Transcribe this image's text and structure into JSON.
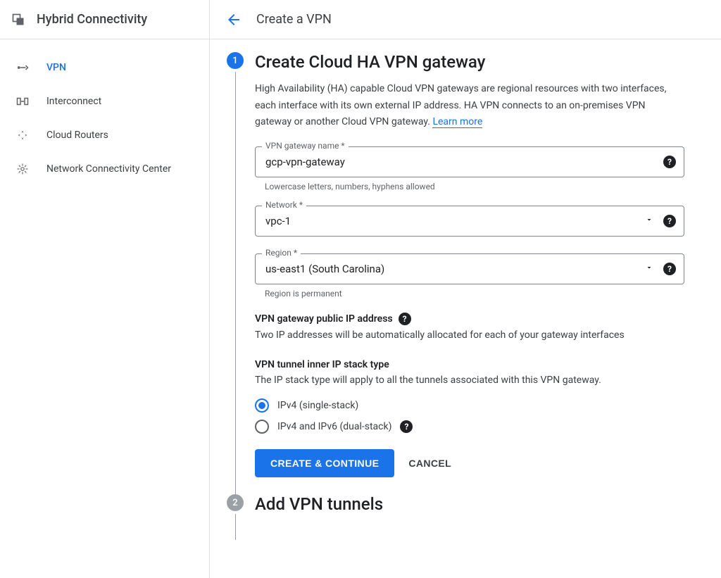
{
  "sidebar": {
    "title": "Hybrid Connectivity",
    "items": [
      {
        "label": "VPN",
        "active": true
      },
      {
        "label": "Interconnect",
        "active": false
      },
      {
        "label": "Cloud Routers",
        "active": false
      },
      {
        "label": "Network Connectivity Center",
        "active": false
      }
    ]
  },
  "header": {
    "title": "Create a VPN"
  },
  "step1": {
    "number": "1",
    "title": "Create Cloud HA VPN gateway",
    "description_prefix": "High Availability (HA) capable Cloud VPN gateways are regional resources with two interfaces, each interface with its own external IP address. HA VPN connects to an on-premises VPN gateway or another Cloud VPN gateway. ",
    "learn_more": "Learn more",
    "fields": {
      "name_label": "VPN gateway name *",
      "name_value": "gcp-vpn-gateway",
      "name_helper": "Lowercase letters, numbers, hyphens allowed",
      "network_label": "Network *",
      "network_value": "vpc-1",
      "region_label": "Region *",
      "region_value": "us-east1 (South Carolina)",
      "region_helper": "Region is permanent"
    },
    "ip_section": {
      "label": "VPN gateway public IP address",
      "text": "Two IP addresses will be automatically allocated for each of your gateway interfaces"
    },
    "stack_section": {
      "label": "VPN tunnel inner IP stack type",
      "text": "The IP stack type will apply to all the tunnels associated with this VPN gateway.",
      "option1": "IPv4 (single-stack)",
      "option2": "IPv4 and IPv6 (dual-stack)"
    },
    "buttons": {
      "primary": "CREATE & CONTINUE",
      "cancel": "CANCEL"
    }
  },
  "step2": {
    "number": "2",
    "title": "Add VPN tunnels"
  }
}
